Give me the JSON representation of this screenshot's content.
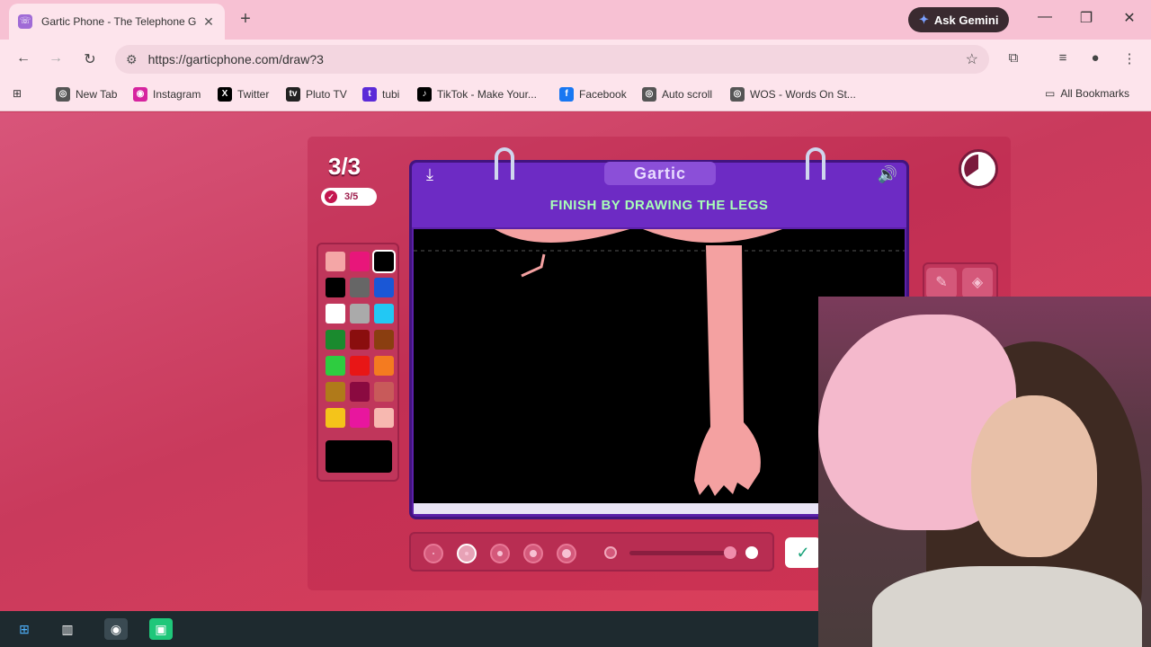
{
  "browser": {
    "tab_title": "Gartic Phone - The Telephone G",
    "tab_icon_glyph": "☏",
    "new_tab_glyph": "+",
    "ask_gemini": "Ask Gemini",
    "url": "https://garticphone.com/draw?3"
  },
  "bookmarks": [
    {
      "label": "New Tab",
      "icon": "globe-icon",
      "color": "#555555"
    },
    {
      "label": "Instagram",
      "icon": "instagram-icon",
      "color": "#d6249f"
    },
    {
      "label": "Twitter",
      "icon": "x-icon",
      "color": "#000000"
    },
    {
      "label": "Pluto TV",
      "icon": "pluto-tv-icon",
      "color": "#222222"
    },
    {
      "label": "tubi",
      "icon": "tubi-icon",
      "color": "#5b2bd8"
    },
    {
      "label": "TikTok - Make Your...",
      "icon": "tiktok-icon",
      "color": "#000000"
    },
    {
      "label": "Facebook",
      "icon": "facebook-icon",
      "color": "#1877f2"
    },
    {
      "label": "Auto scroll",
      "icon": "globe-icon",
      "color": "#555555"
    },
    {
      "label": "WOS - Words On St...",
      "icon": "globe-icon",
      "color": "#555555"
    }
  ],
  "all_bookmarks": "All Bookmarks",
  "game": {
    "round": "3/3",
    "done_count": "3/5",
    "logo": "Gartic",
    "instruction": "FINISH BY DRAWING THE LEGS",
    "palette": [
      "#f4a6a6",
      "#e8167a",
      "#000000",
      "#000000",
      "#666666",
      "#1a57d6",
      "#ffffff",
      "#aaaaaa",
      "#22c8f4",
      "#1a8a2e",
      "#8a0e0e",
      "#8a3e10",
      "#2ecc40",
      "#e81616",
      "#f47b20",
      "#b07a1a",
      "#8a0a40",
      "#c85a5a",
      "#f4c41a",
      "#e8169e",
      "#f7b8b0"
    ],
    "current_color": "#000000",
    "drawing_color": "#f4a1a1",
    "brush_sizes": 5,
    "selected_brush": 2
  }
}
